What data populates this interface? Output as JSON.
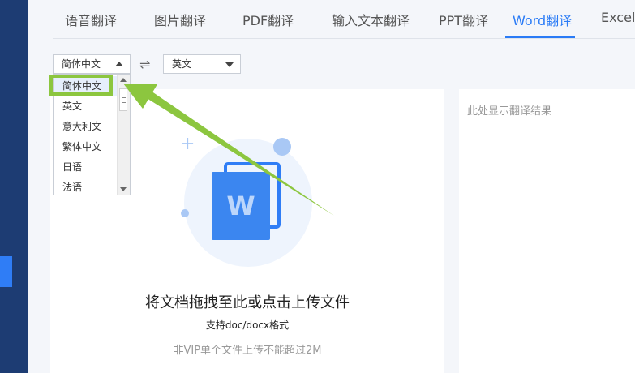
{
  "tabs": [
    {
      "label": "语音翻译"
    },
    {
      "label": "图片翻译"
    },
    {
      "label": "PDF翻译"
    },
    {
      "label": "输入文本翻译"
    },
    {
      "label": "PPT翻译"
    },
    {
      "label": "Word翻译"
    },
    {
      "label": "Excel"
    }
  ],
  "active_tab": "Word翻译",
  "source_lang": {
    "value": "简体中文",
    "options": [
      "简体中文",
      "英文",
      "意大利文",
      "繁体中文",
      "日语",
      "法语"
    ]
  },
  "target_lang": {
    "value": "英文"
  },
  "upload": {
    "icon_letter": "W",
    "title": "将文档拖拽至此或点击上传文件",
    "formats": "支持doc/docx格式",
    "limit": "非VIP单个文件上传不能超过2M"
  },
  "result": {
    "placeholder": "此处显示翻译结果"
  },
  "colors": {
    "accent": "#2a7bf6",
    "sidebar": "#1d3c73",
    "highlight": "#8cc63f"
  }
}
